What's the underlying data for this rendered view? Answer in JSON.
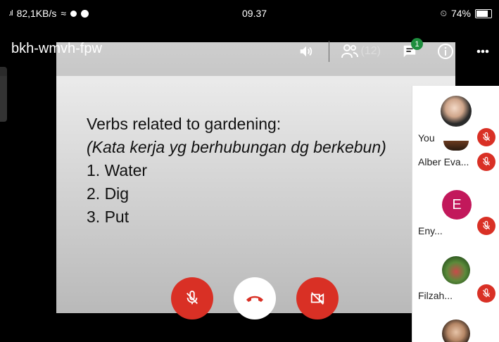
{
  "status_bar": {
    "network_speed": "82,1KB/s",
    "time": "09.37",
    "battery": "74%"
  },
  "meeting": {
    "code": "bkh-wmvh-fpw",
    "participants_count": "(12)",
    "chat_badge": "1"
  },
  "slide": {
    "heading": "Verbs related to gardening:",
    "subheading": "(Kata kerja yg berhubungan dg berkebun)",
    "items": [
      "1. Water",
      "2. Dig",
      "3. Put"
    ]
  },
  "participants": [
    {
      "name": "You",
      "muted": true
    },
    {
      "name": "Alber Eva...",
      "muted": true
    },
    {
      "name": "Eny...",
      "initial": "E",
      "avatar_color": "#c2185b",
      "muted": true
    },
    {
      "name": "Filzah...",
      "muted": true
    }
  ],
  "colors": {
    "danger": "#d93025",
    "badge": "#1e8e3e"
  },
  "icons": [
    "speaker-icon",
    "people-icon",
    "chat-icon",
    "info-icon",
    "more-icon",
    "mic-off-icon",
    "hangup-icon",
    "camera-off-icon"
  ]
}
